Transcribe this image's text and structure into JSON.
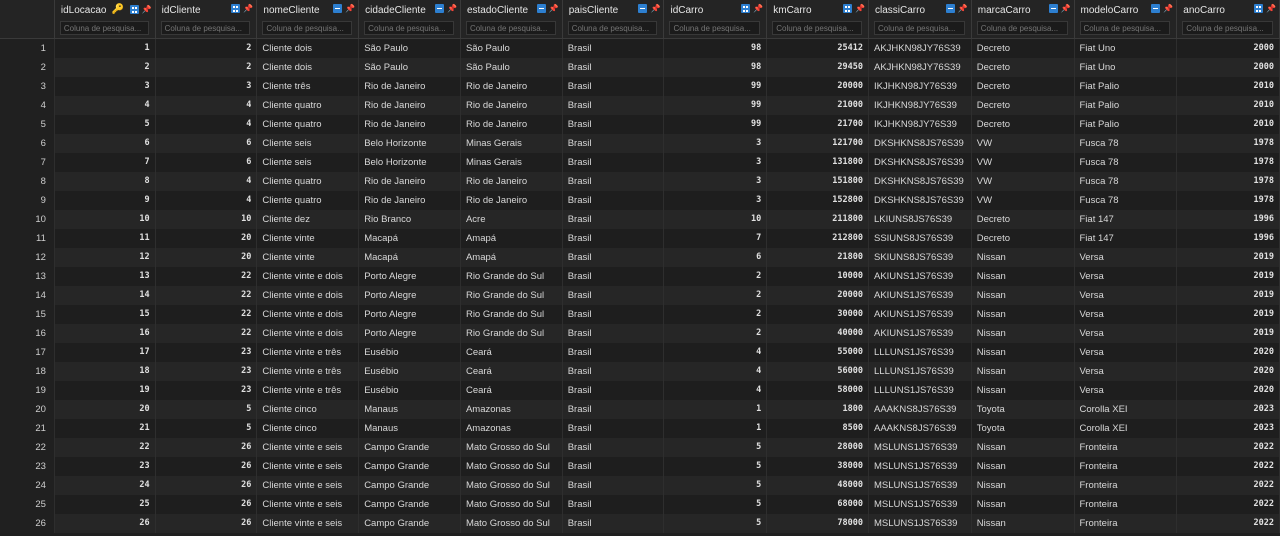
{
  "columns": [
    {
      "name": "idLocacao",
      "type": "num",
      "key": true,
      "placeholder": "Coluna de pesquisa..."
    },
    {
      "name": "idCliente",
      "type": "num",
      "key": false,
      "placeholder": "Coluna de pesquisa..."
    },
    {
      "name": "nomeCliente",
      "type": "txt",
      "key": false,
      "placeholder": "Coluna de pesquisa..."
    },
    {
      "name": "cidadeCliente",
      "type": "txt",
      "key": false,
      "placeholder": "Coluna de pesquisa..."
    },
    {
      "name": "estadoCliente",
      "type": "txt",
      "key": false,
      "placeholder": "Coluna de pesquisa..."
    },
    {
      "name": "paisCliente",
      "type": "txt",
      "key": false,
      "placeholder": "Coluna de pesquisa..."
    },
    {
      "name": "idCarro",
      "type": "num",
      "key": false,
      "placeholder": "Coluna de pesquisa..."
    },
    {
      "name": "kmCarro",
      "type": "num",
      "key": false,
      "placeholder": "Coluna de pesquisa..."
    },
    {
      "name": "classiCarro",
      "type": "txt",
      "key": false,
      "placeholder": "Coluna de pesquisa..."
    },
    {
      "name": "marcaCarro",
      "type": "txt",
      "key": false,
      "placeholder": "Coluna de pesquisa..."
    },
    {
      "name": "modeloCarro",
      "type": "txt",
      "key": false,
      "placeholder": "Coluna de pesquisa..."
    },
    {
      "name": "anoCarro",
      "type": "num",
      "key": false,
      "placeholder": "Coluna de pesquisa..."
    }
  ],
  "rows": [
    [
      "1",
      "1",
      "2",
      "Cliente dois",
      "São Paulo",
      "São Paulo",
      "Brasil",
      "98",
      "25412",
      "AKJHKN98JY76S39",
      "Decreto",
      "Fiat Uno",
      "2000"
    ],
    [
      "2",
      "2",
      "2",
      "Cliente dois",
      "São Paulo",
      "São Paulo",
      "Brasil",
      "98",
      "29450",
      "AKJHKN98JY76S39",
      "Decreto",
      "Fiat Uno",
      "2000"
    ],
    [
      "3",
      "3",
      "3",
      "Cliente três",
      "Rio de Janeiro",
      "Rio de Janeiro",
      "Brasil",
      "99",
      "20000",
      "IKJHKN98JY76S39",
      "Decreto",
      "Fiat Palio",
      "2010"
    ],
    [
      "4",
      "4",
      "4",
      "Cliente quatro",
      "Rio de Janeiro",
      "Rio de Janeiro",
      "Brasil",
      "99",
      "21000",
      "IKJHKN98JY76S39",
      "Decreto",
      "Fiat Palio",
      "2010"
    ],
    [
      "5",
      "5",
      "4",
      "Cliente quatro",
      "Rio de Janeiro",
      "Rio de Janeiro",
      "Brasil",
      "99",
      "21700",
      "IKJHKN98JY76S39",
      "Decreto",
      "Fiat Palio",
      "2010"
    ],
    [
      "6",
      "6",
      "6",
      "Cliente seis",
      "Belo Horizonte",
      "Minas Gerais",
      "Brasil",
      "3",
      "121700",
      "DKSHKNS8JS76S39",
      "VW",
      "Fusca 78",
      "1978"
    ],
    [
      "7",
      "7",
      "6",
      "Cliente seis",
      "Belo Horizonte",
      "Minas Gerais",
      "Brasil",
      "3",
      "131800",
      "DKSHKNS8JS76S39",
      "VW",
      "Fusca 78",
      "1978"
    ],
    [
      "8",
      "8",
      "4",
      "Cliente quatro",
      "Rio de Janeiro",
      "Rio de Janeiro",
      "Brasil",
      "3",
      "151800",
      "DKSHKNS8JS76S39",
      "VW",
      "Fusca 78",
      "1978"
    ],
    [
      "9",
      "9",
      "4",
      "Cliente quatro",
      "Rio de Janeiro",
      "Rio de Janeiro",
      "Brasil",
      "3",
      "152800",
      "DKSHKNS8JS76S39",
      "VW",
      "Fusca 78",
      "1978"
    ],
    [
      "10",
      "10",
      "10",
      "Cliente dez",
      "Rio Branco",
      "Acre",
      "Brasil",
      "10",
      "211800",
      "LKIUNS8JS76S39",
      "Decreto",
      "Fiat 147",
      "1996"
    ],
    [
      "11",
      "11",
      "20",
      "Cliente vinte",
      "Macapá",
      "Amapá",
      "Brasil",
      "7",
      "212800",
      "SSIUNS8JS76S39",
      "Decreto",
      "Fiat 147",
      "1996"
    ],
    [
      "12",
      "12",
      "20",
      "Cliente vinte",
      "Macapá",
      "Amapá",
      "Brasil",
      "6",
      "21800",
      "SKIUNS8JS76S39",
      "Nissan",
      "Versa",
      "2019"
    ],
    [
      "13",
      "13",
      "22",
      "Cliente vinte e dois",
      "Porto Alegre",
      "Rio Grande do Sul",
      "Brasil",
      "2",
      "10000",
      "AKIUNS1JS76S39",
      "Nissan",
      "Versa",
      "2019"
    ],
    [
      "14",
      "14",
      "22",
      "Cliente vinte e dois",
      "Porto Alegre",
      "Rio Grande do Sul",
      "Brasil",
      "2",
      "20000",
      "AKIUNS1JS76S39",
      "Nissan",
      "Versa",
      "2019"
    ],
    [
      "15",
      "15",
      "22",
      "Cliente vinte e dois",
      "Porto Alegre",
      "Rio Grande do Sul",
      "Brasil",
      "2",
      "30000",
      "AKIUNS1JS76S39",
      "Nissan",
      "Versa",
      "2019"
    ],
    [
      "16",
      "16",
      "22",
      "Cliente vinte e dois",
      "Porto Alegre",
      "Rio Grande do Sul",
      "Brasil",
      "2",
      "40000",
      "AKIUNS1JS76S39",
      "Nissan",
      "Versa",
      "2019"
    ],
    [
      "17",
      "17",
      "23",
      "Cliente vinte e três",
      "Eusébio",
      "Ceará",
      "Brasil",
      "4",
      "55000",
      "LLLUNS1JS76S39",
      "Nissan",
      "Versa",
      "2020"
    ],
    [
      "18",
      "18",
      "23",
      "Cliente vinte e três",
      "Eusébio",
      "Ceará",
      "Brasil",
      "4",
      "56000",
      "LLLUNS1JS76S39",
      "Nissan",
      "Versa",
      "2020"
    ],
    [
      "19",
      "19",
      "23",
      "Cliente vinte e três",
      "Eusébio",
      "Ceará",
      "Brasil",
      "4",
      "58000",
      "LLLUNS1JS76S39",
      "Nissan",
      "Versa",
      "2020"
    ],
    [
      "20",
      "20",
      "5",
      "Cliente cinco",
      "Manaus",
      "Amazonas",
      "Brasil",
      "1",
      "1800",
      "AAAKNS8JS76S39",
      "Toyota",
      "Corolla XEI",
      "2023"
    ],
    [
      "21",
      "21",
      "5",
      "Cliente cinco",
      "Manaus",
      "Amazonas",
      "Brasil",
      "1",
      "8500",
      "AAAKNS8JS76S39",
      "Toyota",
      "Corolla XEI",
      "2023"
    ],
    [
      "22",
      "22",
      "26",
      "Cliente vinte e seis",
      "Campo Grande",
      "Mato Grosso do Sul",
      "Brasil",
      "5",
      "28000",
      "MSLUNS1JS76S39",
      "Nissan",
      "Fronteira",
      "2022"
    ],
    [
      "23",
      "23",
      "26",
      "Cliente vinte e seis",
      "Campo Grande",
      "Mato Grosso do Sul",
      "Brasil",
      "5",
      "38000",
      "MSLUNS1JS76S39",
      "Nissan",
      "Fronteira",
      "2022"
    ],
    [
      "24",
      "24",
      "26",
      "Cliente vinte e seis",
      "Campo Grande",
      "Mato Grosso do Sul",
      "Brasil",
      "5",
      "48000",
      "MSLUNS1JS76S39",
      "Nissan",
      "Fronteira",
      "2022"
    ],
    [
      "25",
      "25",
      "26",
      "Cliente vinte e seis",
      "Campo Grande",
      "Mato Grosso do Sul",
      "Brasil",
      "5",
      "68000",
      "MSLUNS1JS76S39",
      "Nissan",
      "Fronteira",
      "2022"
    ],
    [
      "26",
      "26",
      "26",
      "Cliente vinte e seis",
      "Campo Grande",
      "Mato Grosso do Sul",
      "Brasil",
      "5",
      "78000",
      "MSLUNS1JS76S39",
      "Nissan",
      "Fronteira",
      "2022"
    ]
  ],
  "colors": {
    "filter_icon": "#2d7fd0",
    "pin_icon": "#e0403a",
    "key_icon": "#e5b128"
  },
  "icons": {
    "key": "key-icon",
    "filter": "filter-icon",
    "pin": "pin-icon"
  }
}
